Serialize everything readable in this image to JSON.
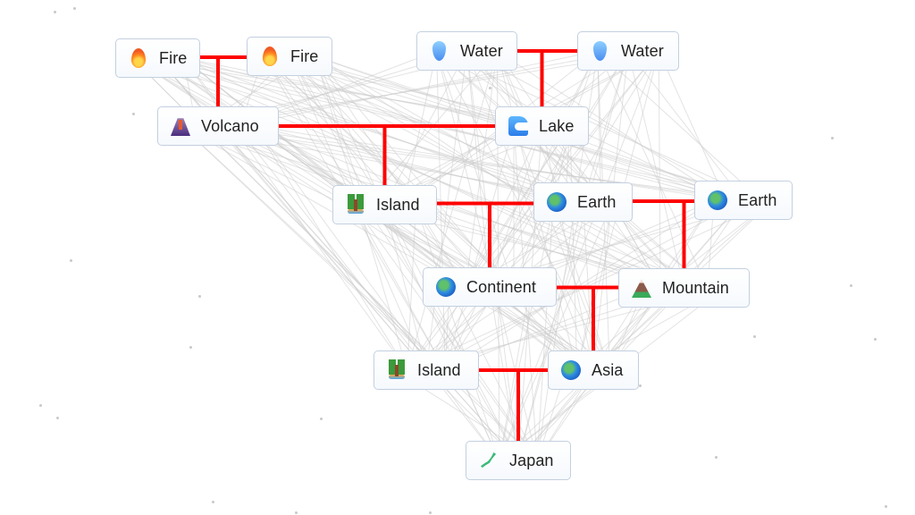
{
  "canvas": {
    "background": "#ffffff",
    "recipe_line_color": "#ff0000",
    "background_line_color": "#cccccc"
  },
  "nodes": [
    {
      "id": "fire-1",
      "label": "Fire",
      "icon": "fire-icon"
    },
    {
      "id": "fire-2",
      "label": "Fire",
      "icon": "fire-icon"
    },
    {
      "id": "water-1",
      "label": "Water",
      "icon": "water-drop-icon"
    },
    {
      "id": "water-2",
      "label": "Water",
      "icon": "water-drop-icon"
    },
    {
      "id": "volcano",
      "label": "Volcano",
      "icon": "volcano-icon"
    },
    {
      "id": "lake",
      "label": "Lake",
      "icon": "wave-icon"
    },
    {
      "id": "island-1",
      "label": "Island",
      "icon": "desert-island-icon"
    },
    {
      "id": "earth-1",
      "label": "Earth",
      "icon": "globe-icon"
    },
    {
      "id": "earth-2",
      "label": "Earth",
      "icon": "globe-icon"
    },
    {
      "id": "continent",
      "label": "Continent",
      "icon": "globe-icon"
    },
    {
      "id": "mountain",
      "label": "Mountain",
      "icon": "mountain-icon"
    },
    {
      "id": "island-2",
      "label": "Island",
      "icon": "desert-island-icon"
    },
    {
      "id": "asia",
      "label": "Asia",
      "icon": "globe-icon"
    },
    {
      "id": "japan",
      "label": "Japan",
      "icon": "japan-map-icon"
    }
  ],
  "recipes": [
    {
      "inputs": [
        "fire-1",
        "fire-2"
      ],
      "output": "volcano"
    },
    {
      "inputs": [
        "water-1",
        "water-2"
      ],
      "output": "lake"
    },
    {
      "inputs": [
        "volcano",
        "lake"
      ],
      "output": "island-1"
    },
    {
      "inputs": [
        "island-1",
        "earth-1"
      ],
      "output": "continent"
    },
    {
      "inputs": [
        "earth-1",
        "earth-2"
      ],
      "output": "mountain"
    },
    {
      "inputs": [
        "continent",
        "mountain"
      ],
      "output": "asia"
    },
    {
      "inputs": [
        "island-2",
        "asia"
      ],
      "output": "japan"
    }
  ]
}
